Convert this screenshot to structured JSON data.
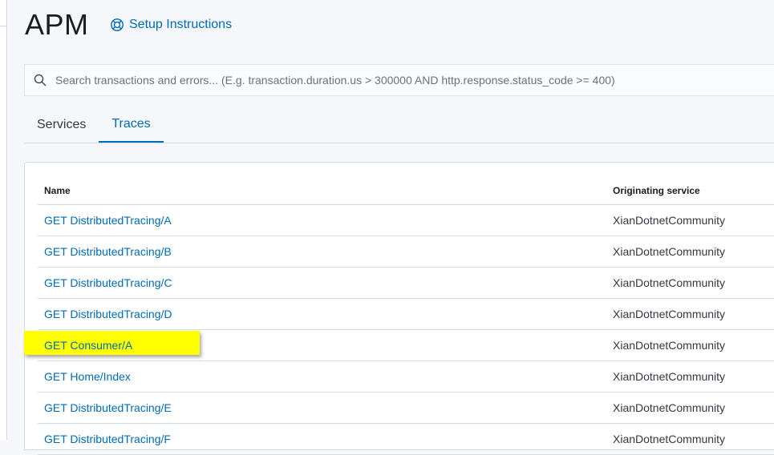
{
  "header": {
    "title": "APM",
    "setup_label": "Setup Instructions"
  },
  "search": {
    "placeholder": "Search transactions and errors... (E.g. transaction.duration.us > 300000 AND http.response.status_code >= 400)",
    "value": ""
  },
  "tabs": [
    {
      "label": "Services",
      "active": false
    },
    {
      "label": "Traces",
      "active": true
    }
  ],
  "table": {
    "columns": {
      "name": "Name",
      "service": "Originating service"
    },
    "rows": [
      {
        "name": "GET DistributedTracing/A",
        "service": "XianDotnetCommunity"
      },
      {
        "name": "GET DistributedTracing/B",
        "service": "XianDotnetCommunity"
      },
      {
        "name": "GET DistributedTracing/C",
        "service": "XianDotnetCommunity"
      },
      {
        "name": "GET DistributedTracing/D",
        "service": "XianDotnetCommunity"
      },
      {
        "name": "GET Consumer/A",
        "service": "XianDotnetCommunity",
        "highlighted": true
      },
      {
        "name": "GET Home/Index",
        "service": "XianDotnetCommunity"
      },
      {
        "name": "GET DistributedTracing/E",
        "service": "XianDotnetCommunity"
      },
      {
        "name": "GET DistributedTracing/F",
        "service": "XianDotnetCommunity"
      }
    ]
  },
  "icons": {
    "setup": "lifebuoy-icon",
    "search": "search-icon"
  },
  "colors": {
    "link": "#006bb4",
    "highlight": "#ffff00",
    "border": "#d3dae6"
  }
}
